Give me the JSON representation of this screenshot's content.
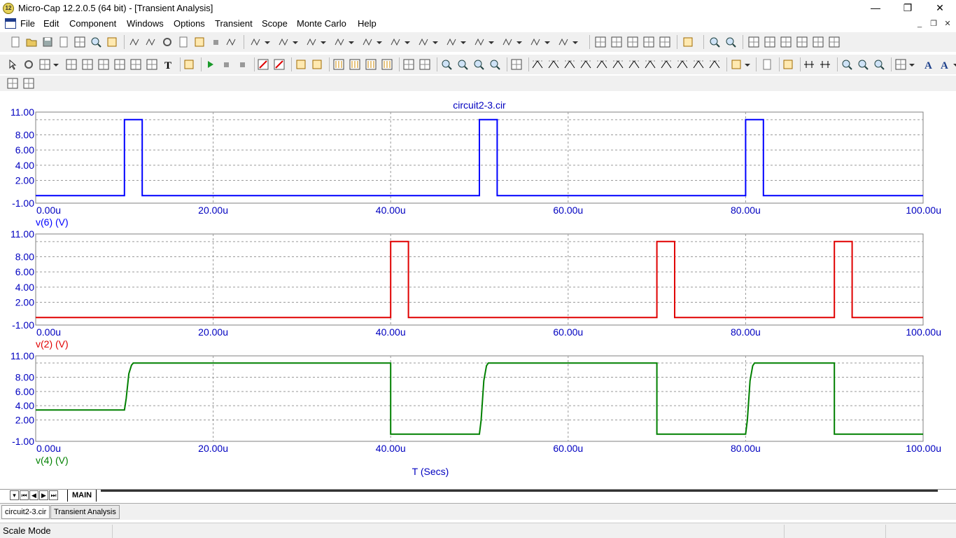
{
  "window": {
    "title": "Micro-Cap 12.2.0.5 (64 bit) - [Transient Analysis]",
    "app_icon_text": "12",
    "minimize_glyph": "—",
    "maximize_glyph": "❐",
    "close_glyph": "✕"
  },
  "menu": {
    "items": [
      "File",
      "Edit",
      "Component",
      "Windows",
      "Options",
      "Transient",
      "Scope",
      "Monte Carlo",
      "Help"
    ]
  },
  "mdi": {
    "minimize_glyph": "_",
    "restore_glyph": "❐",
    "close_glyph": "✕"
  },
  "plot": {
    "title": "circuit2-3.cir",
    "x_axis_label": "T (Secs)",
    "colors": {
      "axis_text": "#0000c0",
      "grid": "#9a9a9a",
      "frame": "#808080"
    }
  },
  "chart_data": [
    {
      "type": "line",
      "title": "circuit2-3.cir",
      "xlabel": "",
      "ylabel": "v(6) (V)",
      "x_ticks": [
        "0.00u",
        "20.00u",
        "40.00u",
        "60.00u",
        "80.00u",
        "100.00u"
      ],
      "y_ticks": [
        "11.00",
        "8.00",
        "6.00",
        "4.00",
        "2.00",
        "-1.00"
      ],
      "xlim": [
        0,
        100
      ],
      "ylim": [
        -1,
        11
      ],
      "grid": true,
      "series": [
        {
          "name": "v(6) (V)",
          "color": "#0000ff",
          "x": [
            0,
            10,
            10,
            12,
            12,
            50,
            50,
            52,
            52,
            80,
            80,
            82,
            82,
            100
          ],
          "y": [
            0,
            0,
            10,
            10,
            0,
            0,
            10,
            10,
            0,
            0,
            10,
            10,
            0,
            0
          ]
        }
      ]
    },
    {
      "type": "line",
      "xlabel": "",
      "ylabel": "v(2) (V)",
      "x_ticks": [
        "0.00u",
        "20.00u",
        "40.00u",
        "60.00u",
        "80.00u",
        "100.00u"
      ],
      "y_ticks": [
        "11.00",
        "8.00",
        "6.00",
        "4.00",
        "2.00",
        "-1.00"
      ],
      "xlim": [
        0,
        100
      ],
      "ylim": [
        -1,
        11
      ],
      "grid": true,
      "series": [
        {
          "name": "v(2) (V)",
          "color": "#e00000",
          "x": [
            0,
            40,
            40,
            42,
            42,
            70,
            70,
            72,
            72,
            90,
            90,
            92,
            92,
            100
          ],
          "y": [
            0,
            0,
            10,
            10,
            0,
            0,
            10,
            10,
            0,
            0,
            10,
            10,
            0,
            0
          ]
        }
      ]
    },
    {
      "type": "line",
      "xlabel": "T (Secs)",
      "ylabel": "v(4) (V)",
      "x_ticks": [
        "0.00u",
        "20.00u",
        "40.00u",
        "60.00u",
        "80.00u",
        "100.00u"
      ],
      "y_ticks": [
        "11.00",
        "8.00",
        "6.00",
        "4.00",
        "2.00",
        "-1.00"
      ],
      "xlim": [
        0,
        100
      ],
      "ylim": [
        -1,
        11
      ],
      "grid": true,
      "series": [
        {
          "name": "v(4) (V)",
          "color": "#008000",
          "x": [
            0,
            10,
            10.2,
            10.5,
            10.8,
            11,
            40,
            40,
            50,
            50.2,
            50.5,
            50.8,
            51,
            70,
            70,
            80,
            80.2,
            80.5,
            80.8,
            81,
            90,
            90,
            100
          ],
          "y": [
            3.4,
            3.4,
            5,
            8.5,
            9.7,
            10,
            10,
            0,
            0,
            2,
            7.5,
            9.6,
            10,
            10,
            0,
            0,
            2,
            7.5,
            9.6,
            10,
            10,
            0,
            0
          ]
        }
      ]
    }
  ],
  "sheet_tabs": {
    "active": "MAIN"
  },
  "document_tabs": [
    "circuit2-3.cir",
    "Transient Analysis"
  ],
  "status": {
    "mode": "Scale Mode"
  }
}
